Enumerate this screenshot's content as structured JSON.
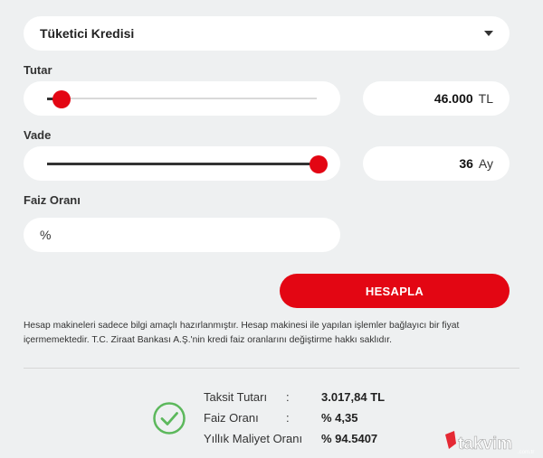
{
  "loan_type": {
    "selected": "Tüketici Kredisi"
  },
  "amount": {
    "label": "Tutar",
    "value": "46.000",
    "unit": "TL",
    "slider_fraction": 0.05
  },
  "term": {
    "label": "Vade",
    "value": "36",
    "unit": "Ay",
    "slider_fraction": 1.0
  },
  "rate": {
    "label": "Faiz Oranı",
    "prefix": "%"
  },
  "calculate_button": {
    "label": "HESAPLA"
  },
  "disclaimer": {
    "line1": "Hesap makineleri sadece bilgi amaçlı hazırlanmıştır. Hesap makinesi ile yapılan işlemler bağlayıcı bir fiyat",
    "line2": "içermemektedir. T.C. Ziraat Bankası A.Ş.'nin kredi faiz oranlarını değiştirme hakkı saklıdır."
  },
  "results": [
    {
      "label": "Taksit Tutarı",
      "value": "3.017,84 TL"
    },
    {
      "label": "Faiz Oranı",
      "value": "% 4,35"
    },
    {
      "label": "Yıllık Maliyet Oranı",
      "value": "% 94.5407"
    }
  ],
  "separator": ":",
  "watermark": {
    "text": "takvim",
    "suffix": ".com.tr"
  },
  "colors": {
    "accent": "#e30613",
    "background": "#eef0f1",
    "success": "#5cb85c"
  }
}
